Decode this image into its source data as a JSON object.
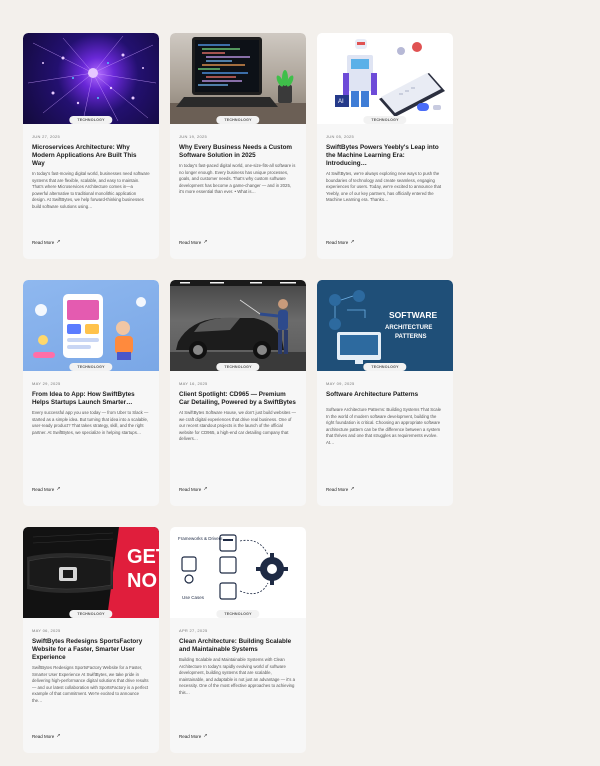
{
  "posts": [
    {
      "tag": "TECHNOLOGY",
      "date": "JUN 27, 2025",
      "title": "Microservices Architecture: Why Modern Applications Are Built This Way",
      "excerpt": "In today's fast-moving digital world, businesses need software systems that are flexible, scalable, and easy to maintain. That's where Microservices Architecture comes in—a powerful alternative to traditional monolithic application design. At SwiftBytes, we help forward-thinking businesses build software solutions using…",
      "read_more": "Read More"
    },
    {
      "tag": "TECHNOLOGY",
      "date": "JUN 19, 2025",
      "title": "Why Every Business Needs a Custom Software Solution in 2025",
      "excerpt": "In today's fast-paced digital world, one-size-fits-all software is no longer enough. Every business has unique processes, goals, and customer needs. That's why custom software development has become a game-changer — and in 2025, it's more essential than ever. • What is…",
      "read_more": "Read More"
    },
    {
      "tag": "TECHNOLOGY",
      "date": "JUN 05, 2025",
      "title": "SwiftBytes Powers Yeebly's Leap into the Machine Learning Era: Introducing…",
      "excerpt": "At SwiftBytes, we're always exploring new ways to push the boundaries of technology and create seamless, engaging experiences for users. Today, we're excited to announce that Yeebly, one of our key partners, has officially entered the Machine Learning era. Thanks…",
      "read_more": "Read More"
    },
    {
      "tag": "TECHNOLOGY",
      "date": "MAY 29, 2025",
      "title": "From Idea to App: How SwiftBytes Helps Startups Launch Smarter…",
      "excerpt": "Every successful app you use today — from Uber to Slack — started as a simple idea. But turning that idea into a scalable, user-ready product? That takes strategy, skill, and the right partner. At SwiftBytes, we specialize in helping startups…",
      "read_more": "Read More"
    },
    {
      "tag": "TECHNOLOGY",
      "date": "MAY 16, 2025",
      "title": "Client Spotlight: CD965 — Premium Car Detailing, Powered by a SwiftBytes",
      "excerpt": "At SwiftBytes Software House, we don't just build websites — we craft digital experiences that drive real business. One of our recent standout projects is the launch of the official website for CD965, a high-end car detailing company that delivers…",
      "read_more": "Read More"
    },
    {
      "tag": "TECHNOLOGY",
      "date": "MAY 09, 2025",
      "title": "Software Architecture Patterns",
      "excerpt": "Software Architecture Patterns: Building Systems That Scale In the world of modern software development, building the right foundation is critical. Choosing an appropriate software architecture pattern can be the difference between a system that thrives and one that struggles as requirements evolve. At…",
      "read_more": "Read More",
      "thumb_text": [
        "SOFTWARE",
        "ARCHITECTURE",
        "PATTERNS"
      ]
    },
    {
      "tag": "TECHNOLOGY",
      "date": "MAY 06, 2025",
      "title": "SwiftBytes Redesigns SportsFactory Website for a Faster, Smarter User Experience",
      "excerpt": "SwiftBytes Redesigns SportsFactory Website for a Faster, Smarter User Experience At SwiftBytes, we take pride in delivering high-performance digital solutions that drive results — and our latest collaboration with SportsFactory is a perfect example of that commitment. We're excited to announce the…",
      "read_more": "Read More",
      "thumb_text": [
        "GET",
        "NO"
      ]
    },
    {
      "tag": "TECHNOLOGY",
      "date": "APR 27, 2025",
      "title": "Clean Architecture: Building Scalable and Maintainable Systems",
      "excerpt": "Building Scalable and Maintainable Systems with Clean Architecture In today's rapidly evolving world of software development, building systems that are scalable, maintainable, and adaptable is not just an advantage — it's a necessity. One of the most effective approaches to achieving this…",
      "read_more": "Read More",
      "thumb_text": [
        "Frameworks & Drivers",
        "Use Cases"
      ]
    }
  ]
}
